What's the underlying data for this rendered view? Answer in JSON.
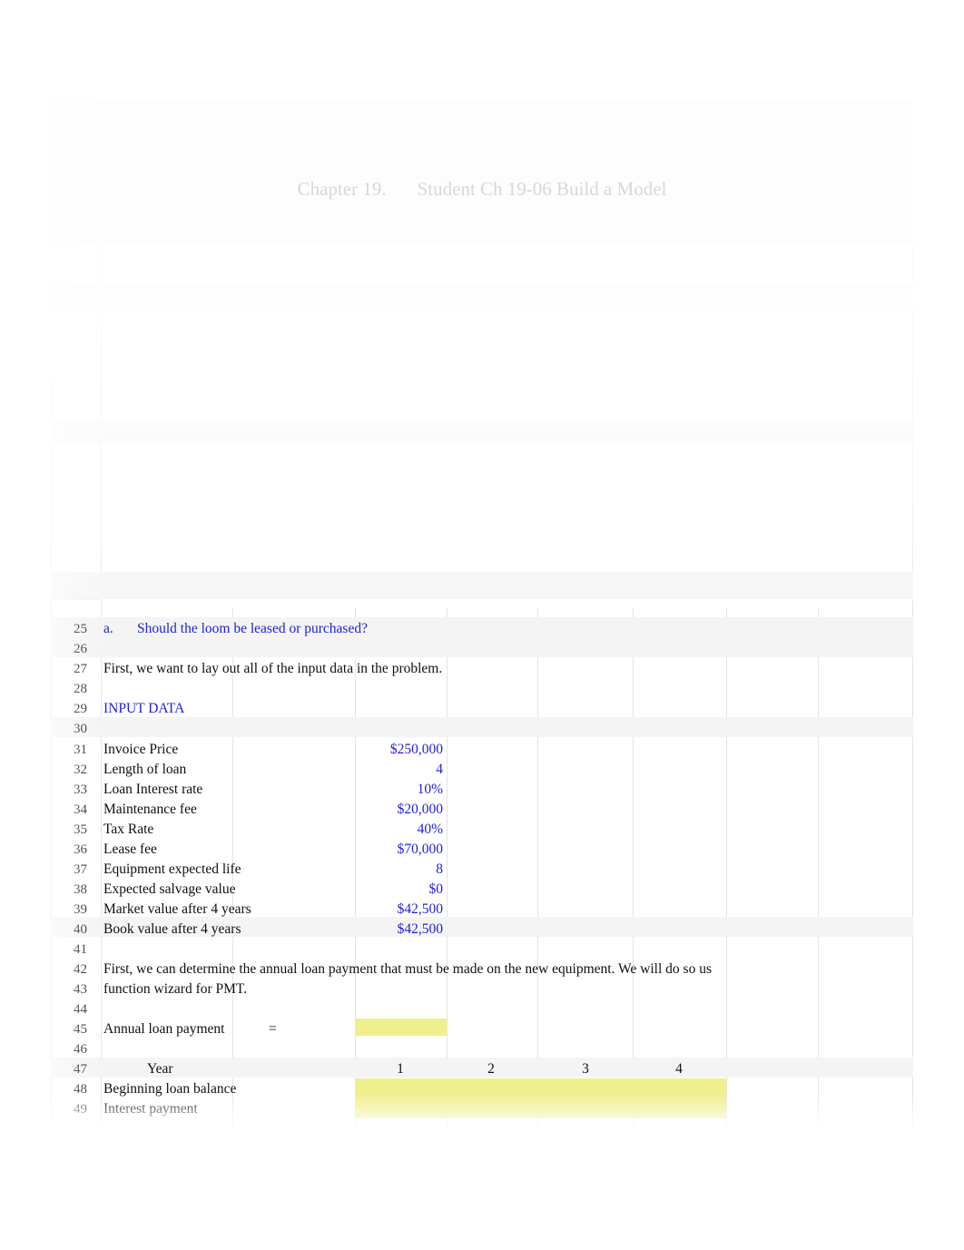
{
  "document": {
    "title_chapter": "Chapter 19.",
    "title_name": "Student Ch 19-06 Build a Model",
    "accent_blue": "#1e1edc",
    "highlight_yellow": "#f0ef8e",
    "grid_line": "#e3e3e3"
  },
  "rows": [
    {
      "num": "25",
      "label": "a.",
      "label2": "Should the loom be leased or purchased?",
      "style": "blue"
    },
    {
      "num": "26",
      "label": "",
      "style": "plain"
    },
    {
      "num": "27",
      "label": "First, we want to lay out all of the input data in the problem.",
      "style": "plain"
    },
    {
      "num": "28",
      "label": "",
      "style": "plain"
    },
    {
      "num": "29",
      "label": "INPUT DATA",
      "style": "blue"
    },
    {
      "num": "30",
      "label": "",
      "style": "plain"
    },
    {
      "num": "31",
      "label": "Invoice Price",
      "value": "$250,000",
      "style": "plain"
    },
    {
      "num": "32",
      "label": "Length of loan",
      "value": "4",
      "style": "plain"
    },
    {
      "num": "33",
      "label": "Loan Interest rate",
      "value": "10%",
      "style": "plain"
    },
    {
      "num": "34",
      "label": "Maintenance fee",
      "value": "$20,000",
      "style": "plain"
    },
    {
      "num": "35",
      "label": "Tax Rate",
      "value": "40%",
      "style": "plain"
    },
    {
      "num": "36",
      "label": "Lease fee",
      "value": "$70,000",
      "style": "plain"
    },
    {
      "num": "37",
      "label": "Equipment expected life",
      "value": "8",
      "style": "plain"
    },
    {
      "num": "38",
      "label": "Expected salvage value",
      "value": "$0",
      "style": "plain"
    },
    {
      "num": "39",
      "label": "Market value after 4 years",
      "value": "$42,500",
      "style": "plain"
    },
    {
      "num": "40",
      "label": "Book value after 4 years",
      "value": "$42,500",
      "style": "plain"
    },
    {
      "num": "41",
      "label": "",
      "style": "plain"
    },
    {
      "num": "42",
      "label": "First, we can determine the annual loan payment that must be made on the new equipment. We will do so us",
      "style": "plain"
    },
    {
      "num": "43",
      "label": "function wizard for PMT.",
      "style": "plain"
    },
    {
      "num": "44",
      "label": "",
      "style": "plain"
    },
    {
      "num": "45",
      "label": "Annual loan payment",
      "marker": "=",
      "style": "plain"
    },
    {
      "num": "46",
      "label": "",
      "style": "plain"
    },
    {
      "num": "47",
      "label": "Year",
      "style": "year"
    },
    {
      "num": "48",
      "label": "Beginning loan balance",
      "style": "plain"
    },
    {
      "num": "49",
      "label": "Interest payment",
      "style": "plain"
    }
  ],
  "loan_table": {
    "year_header": "Year",
    "years": [
      "1",
      "2",
      "3",
      "4"
    ],
    "row_labels": [
      "Beginning loan balance",
      "Interest payment"
    ]
  },
  "input_data": {
    "section_heading": "INPUT DATA",
    "items": [
      {
        "label": "Invoice Price",
        "value": "$250,000"
      },
      {
        "label": "Length of loan",
        "value": "4"
      },
      {
        "label": "Loan Interest rate",
        "value": "10%"
      },
      {
        "label": "Maintenance fee",
        "value": "$20,000"
      },
      {
        "label": "Tax Rate",
        "value": "40%"
      },
      {
        "label": "Lease fee",
        "value": "$70,000"
      },
      {
        "label": "Equipment expected life",
        "value": "8"
      },
      {
        "label": "Expected salvage value",
        "value": "$0"
      },
      {
        "label": "Market value after 4 years",
        "value": "$42,500"
      },
      {
        "label": "Book value after 4 years",
        "value": "$42,500"
      }
    ]
  },
  "question": {
    "marker": "a.",
    "text": "Should the loom be leased or purchased?"
  },
  "narrative": {
    "line_27": "First, we want to lay out all of the input data in the problem.",
    "line_42": "First, we can determine the annual loan payment that must be made on the new equipment. We will do so us",
    "line_43": "function wizard for PMT.",
    "annual_loan_payment_label": "Annual loan payment",
    "equals": "="
  }
}
